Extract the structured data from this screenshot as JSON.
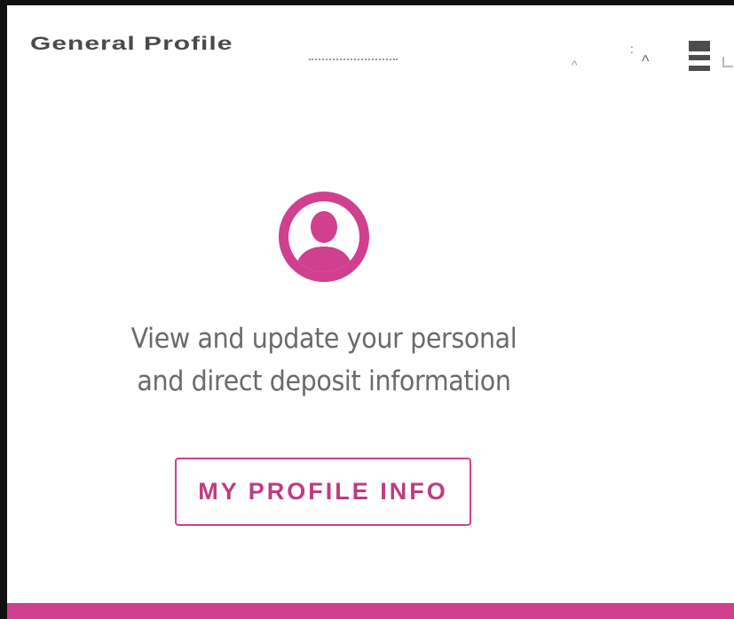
{
  "header": {
    "title": "General Profile",
    "chevron_glyph": "^",
    "more_glyph": ":",
    "icons": [
      "chevron-up-icon",
      "more-vert-icon",
      "grid-view-icon"
    ]
  },
  "card": {
    "avatar_icon": "person-icon",
    "description_line1": "View and update your personal",
    "description_line2": "and direct deposit information",
    "button_label": "MY PROFILE INFO"
  },
  "colors": {
    "accent": "#d13f8f",
    "text": "#6a6a6a",
    "border": "#111111"
  }
}
